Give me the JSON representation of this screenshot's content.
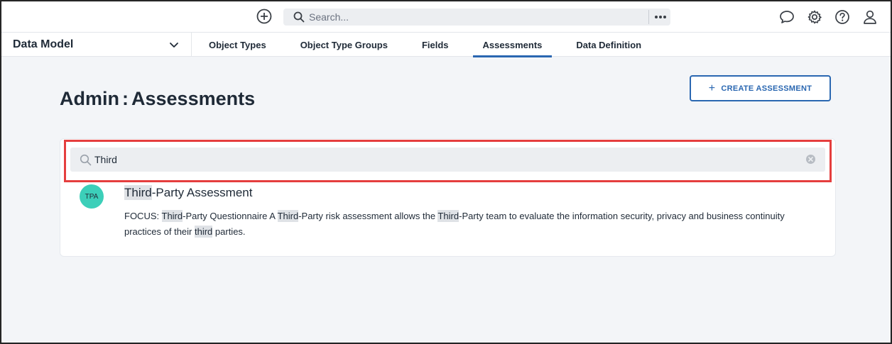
{
  "topbar": {
    "search_placeholder": "Search..."
  },
  "navbar": {
    "module": "Data Model",
    "tabs": [
      {
        "label": "Object Types",
        "active": false
      },
      {
        "label": "Object Type Groups",
        "active": false
      },
      {
        "label": "Fields",
        "active": false
      },
      {
        "label": "Assessments",
        "active": true
      },
      {
        "label": "Data Definition",
        "active": false
      }
    ]
  },
  "page": {
    "title_prefix": "Admin",
    "title_separator": ":",
    "title_main": "Assessments",
    "create_button": "CREATE ASSESSMENT",
    "create_icon": "+"
  },
  "search": {
    "value": "Third"
  },
  "results": [
    {
      "initials": "TPA",
      "title_match": "Third",
      "title_rest": "-Party Assessment",
      "desc": {
        "p1": "FOCUS: ",
        "m1": "Third",
        "p2": "-Party Questionnaire A ",
        "m2": "Third",
        "p3": "-Party risk assessment allows the ",
        "m3": "Third",
        "p4": "-Party team to evaluate the information security, privacy and business continuity practices of their ",
        "m4": "third",
        "p5": " parties."
      }
    }
  ],
  "colors": {
    "accent": "#2a67b1",
    "avatar": "#3ccfb9",
    "highlight_border": "#e53e3e"
  }
}
